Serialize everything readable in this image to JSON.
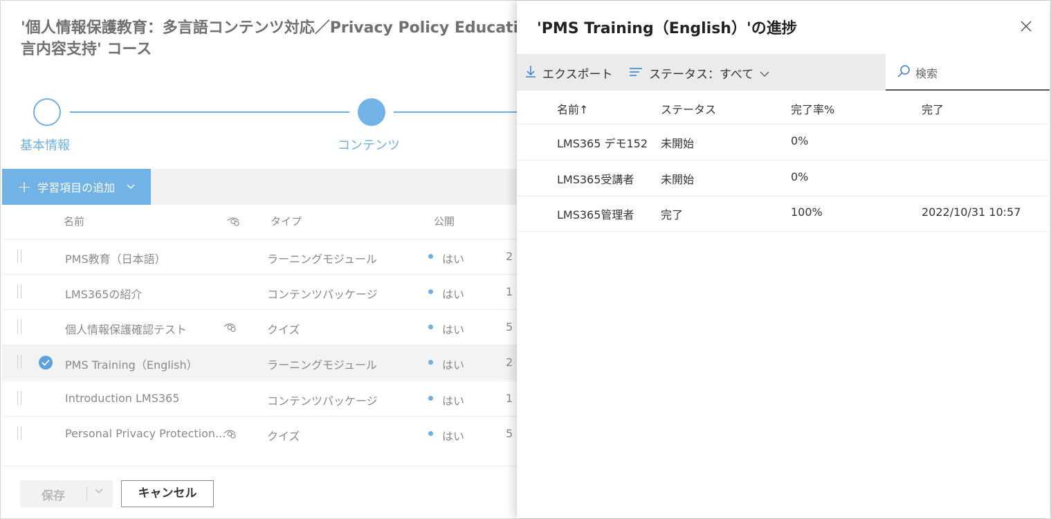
{
  "course": {
    "title_line1": "'個人情報保護教育：多言語コンテンツ対応／Privacy Policy Education",
    "title_line2": "言内容支持' コース"
  },
  "stepper": {
    "steps": [
      {
        "label": "基本情報",
        "state": "done"
      },
      {
        "label": "コンテンツ",
        "state": "current"
      }
    ]
  },
  "content_toolbar": {
    "add_label": "学習項目の追加"
  },
  "content_table": {
    "columns": {
      "name": "名前",
      "type": "タイプ",
      "published": "公開"
    },
    "rows": [
      {
        "name": "PMS教育（日本語）",
        "type": "ラーニングモジュール",
        "published": "はい",
        "count": "2",
        "visibility_icon": false,
        "selected": false
      },
      {
        "name": "LMS365の紹介",
        "type": "コンテンツパッケージ",
        "published": "はい",
        "count": "1",
        "visibility_icon": false,
        "selected": false
      },
      {
        "name": "個人情報保護確認テスト",
        "type": "クイズ",
        "published": "はい",
        "count": "5",
        "visibility_icon": true,
        "selected": false
      },
      {
        "name": "PMS Training（English）",
        "type": "ラーニングモジュール",
        "published": "はい",
        "count": "2",
        "visibility_icon": false,
        "selected": true
      },
      {
        "name": "Introduction LMS365",
        "type": "コンテンツパッケージ",
        "published": "はい",
        "count": "1",
        "visibility_icon": false,
        "selected": false
      },
      {
        "name": "Personal Privacy Protection...",
        "type": "クイズ",
        "published": "はい",
        "count": "5",
        "visibility_icon": true,
        "selected": false
      }
    ]
  },
  "footer": {
    "save_label": "保存",
    "cancel_label": "キャンセル"
  },
  "panel": {
    "title": "'PMS Training（English）'の進捗",
    "export_label": "エクスポート",
    "status_filter_label": "ステータス：すべて",
    "search_placeholder": "検索",
    "columns": {
      "name": "名前↑",
      "status": "ステータス",
      "completion_rate": "完了率%",
      "completed": "完了"
    },
    "rows": [
      {
        "name": "LMS365 デモ152",
        "status": "未開始",
        "rate": "0%",
        "completed": ""
      },
      {
        "name": "LMS365受講者",
        "status": "未開始",
        "rate": "0%",
        "completed": ""
      },
      {
        "name": "LMS365管理者",
        "status": "完了",
        "rate": "100%",
        "completed": "2022/10/31 10:57"
      }
    ]
  },
  "colors": {
    "accent": "#71b3e7",
    "accent_dark": "#4a90c8",
    "text": "#333333",
    "muted": "#8a8a8a"
  }
}
